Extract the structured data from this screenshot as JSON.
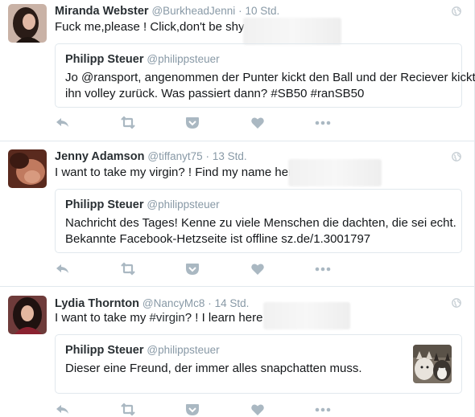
{
  "colors": {
    "icon": "#aab8c2",
    "border": "#e1e8ed",
    "muted": "#8899a6",
    "text": "#14171a"
  },
  "icons": {
    "reply": "reply-icon",
    "retweet": "retweet-icon",
    "pocket": "pocket-icon",
    "like": "heart-icon",
    "more": "more-icon",
    "globe": "globe-icon"
  },
  "tweets": [
    {
      "name": "Miranda Webster",
      "handle": "@BurkheadJenni",
      "time": "10 Std.",
      "text": "Fuck me,please ! Click,don't be shy-",
      "quote": {
        "name": "Philipp Steuer",
        "handle": "@philippsteuer",
        "line1": "Jo @ransport, angenommen der Punter kickt den Ball und der Reciever kickt",
        "line2": "ihn volley zurück. Was passiert dann? #SB50 #ranSB50"
      }
    },
    {
      "name": "Jenny Adamson",
      "handle": "@tiffanyt75",
      "time": "13 Std.",
      "text": "I want to take my virgin? !  Find my name here",
      "quote": {
        "name": "Philipp Steuer",
        "handle": "@philippsteuer",
        "line1": "Nachricht des Tages! Kenne zu viele Menschen die dachten, die sei echt.",
        "line2": "Bekannte Facebook-Hetzseite ist offline sz.de/1.3001797"
      }
    },
    {
      "name": "Lydia Thornton",
      "handle": "@NancyMc8",
      "time": "14 Std.",
      "text_pre": "I want to take my ",
      "hashtag": "#virgin",
      "text_post": "? !  I learn here",
      "quote": {
        "name": "Philipp Steuer",
        "handle": "@philippsteuer",
        "line1": "Dieser eine Freund, der immer alles snapchatten muss."
      }
    }
  ]
}
